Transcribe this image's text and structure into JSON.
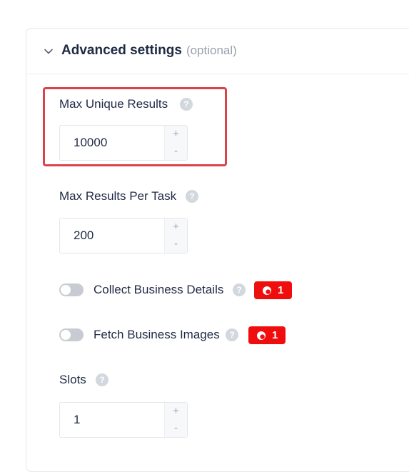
{
  "section": {
    "title": "Advanced settings",
    "optional_label": "(optional)"
  },
  "fields": {
    "max_unique_results": {
      "label": "Max Unique Results",
      "value": "10000"
    },
    "max_results_per_task": {
      "label": "Max Results Per Task",
      "value": "200"
    },
    "collect_business_details": {
      "label": "Collect Business Details",
      "enabled": false,
      "badge_count": "1"
    },
    "fetch_business_images": {
      "label": "Fetch Business Images",
      "enabled": false,
      "badge_count": "1"
    },
    "slots": {
      "label": "Slots",
      "value": "1"
    }
  },
  "stepper": {
    "plus": "+",
    "minus": "-"
  },
  "help_glyph": "?",
  "colors": {
    "highlight": "#d9434b",
    "badge": "#f00d0d",
    "text": "#1f2a44",
    "muted": "#9aa1ad"
  },
  "icons": {
    "collapse": "chevron-down-icon",
    "help": "help-icon",
    "badge": "coin-icon"
  }
}
